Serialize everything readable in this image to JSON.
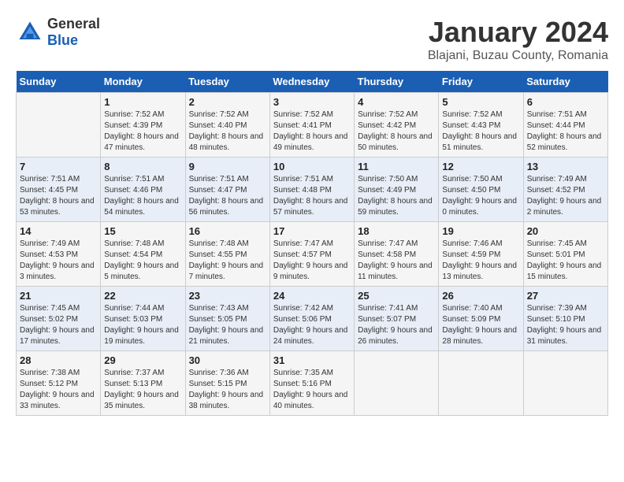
{
  "header": {
    "logo_general": "General",
    "logo_blue": "Blue",
    "month_title": "January 2024",
    "location": "Blajani, Buzau County, Romania"
  },
  "weekdays": [
    "Sunday",
    "Monday",
    "Tuesday",
    "Wednesday",
    "Thursday",
    "Friday",
    "Saturday"
  ],
  "weeks": [
    [
      {
        "day": "",
        "sunrise": "",
        "sunset": "",
        "daylight": ""
      },
      {
        "day": "1",
        "sunrise": "Sunrise: 7:52 AM",
        "sunset": "Sunset: 4:39 PM",
        "daylight": "Daylight: 8 hours and 47 minutes."
      },
      {
        "day": "2",
        "sunrise": "Sunrise: 7:52 AM",
        "sunset": "Sunset: 4:40 PM",
        "daylight": "Daylight: 8 hours and 48 minutes."
      },
      {
        "day": "3",
        "sunrise": "Sunrise: 7:52 AM",
        "sunset": "Sunset: 4:41 PM",
        "daylight": "Daylight: 8 hours and 49 minutes."
      },
      {
        "day": "4",
        "sunrise": "Sunrise: 7:52 AM",
        "sunset": "Sunset: 4:42 PM",
        "daylight": "Daylight: 8 hours and 50 minutes."
      },
      {
        "day": "5",
        "sunrise": "Sunrise: 7:52 AM",
        "sunset": "Sunset: 4:43 PM",
        "daylight": "Daylight: 8 hours and 51 minutes."
      },
      {
        "day": "6",
        "sunrise": "Sunrise: 7:51 AM",
        "sunset": "Sunset: 4:44 PM",
        "daylight": "Daylight: 8 hours and 52 minutes."
      }
    ],
    [
      {
        "day": "7",
        "sunrise": "Sunrise: 7:51 AM",
        "sunset": "Sunset: 4:45 PM",
        "daylight": "Daylight: 8 hours and 53 minutes."
      },
      {
        "day": "8",
        "sunrise": "Sunrise: 7:51 AM",
        "sunset": "Sunset: 4:46 PM",
        "daylight": "Daylight: 8 hours and 54 minutes."
      },
      {
        "day": "9",
        "sunrise": "Sunrise: 7:51 AM",
        "sunset": "Sunset: 4:47 PM",
        "daylight": "Daylight: 8 hours and 56 minutes."
      },
      {
        "day": "10",
        "sunrise": "Sunrise: 7:51 AM",
        "sunset": "Sunset: 4:48 PM",
        "daylight": "Daylight: 8 hours and 57 minutes."
      },
      {
        "day": "11",
        "sunrise": "Sunrise: 7:50 AM",
        "sunset": "Sunset: 4:49 PM",
        "daylight": "Daylight: 8 hours and 59 minutes."
      },
      {
        "day": "12",
        "sunrise": "Sunrise: 7:50 AM",
        "sunset": "Sunset: 4:50 PM",
        "daylight": "Daylight: 9 hours and 0 minutes."
      },
      {
        "day": "13",
        "sunrise": "Sunrise: 7:49 AM",
        "sunset": "Sunset: 4:52 PM",
        "daylight": "Daylight: 9 hours and 2 minutes."
      }
    ],
    [
      {
        "day": "14",
        "sunrise": "Sunrise: 7:49 AM",
        "sunset": "Sunset: 4:53 PM",
        "daylight": "Daylight: 9 hours and 3 minutes."
      },
      {
        "day": "15",
        "sunrise": "Sunrise: 7:48 AM",
        "sunset": "Sunset: 4:54 PM",
        "daylight": "Daylight: 9 hours and 5 minutes."
      },
      {
        "day": "16",
        "sunrise": "Sunrise: 7:48 AM",
        "sunset": "Sunset: 4:55 PM",
        "daylight": "Daylight: 9 hours and 7 minutes."
      },
      {
        "day": "17",
        "sunrise": "Sunrise: 7:47 AM",
        "sunset": "Sunset: 4:57 PM",
        "daylight": "Daylight: 9 hours and 9 minutes."
      },
      {
        "day": "18",
        "sunrise": "Sunrise: 7:47 AM",
        "sunset": "Sunset: 4:58 PM",
        "daylight": "Daylight: 9 hours and 11 minutes."
      },
      {
        "day": "19",
        "sunrise": "Sunrise: 7:46 AM",
        "sunset": "Sunset: 4:59 PM",
        "daylight": "Daylight: 9 hours and 13 minutes."
      },
      {
        "day": "20",
        "sunrise": "Sunrise: 7:45 AM",
        "sunset": "Sunset: 5:01 PM",
        "daylight": "Daylight: 9 hours and 15 minutes."
      }
    ],
    [
      {
        "day": "21",
        "sunrise": "Sunrise: 7:45 AM",
        "sunset": "Sunset: 5:02 PM",
        "daylight": "Daylight: 9 hours and 17 minutes."
      },
      {
        "day": "22",
        "sunrise": "Sunrise: 7:44 AM",
        "sunset": "Sunset: 5:03 PM",
        "daylight": "Daylight: 9 hours and 19 minutes."
      },
      {
        "day": "23",
        "sunrise": "Sunrise: 7:43 AM",
        "sunset": "Sunset: 5:05 PM",
        "daylight": "Daylight: 9 hours and 21 minutes."
      },
      {
        "day": "24",
        "sunrise": "Sunrise: 7:42 AM",
        "sunset": "Sunset: 5:06 PM",
        "daylight": "Daylight: 9 hours and 24 minutes."
      },
      {
        "day": "25",
        "sunrise": "Sunrise: 7:41 AM",
        "sunset": "Sunset: 5:07 PM",
        "daylight": "Daylight: 9 hours and 26 minutes."
      },
      {
        "day": "26",
        "sunrise": "Sunrise: 7:40 AM",
        "sunset": "Sunset: 5:09 PM",
        "daylight": "Daylight: 9 hours and 28 minutes."
      },
      {
        "day": "27",
        "sunrise": "Sunrise: 7:39 AM",
        "sunset": "Sunset: 5:10 PM",
        "daylight": "Daylight: 9 hours and 31 minutes."
      }
    ],
    [
      {
        "day": "28",
        "sunrise": "Sunrise: 7:38 AM",
        "sunset": "Sunset: 5:12 PM",
        "daylight": "Daylight: 9 hours and 33 minutes."
      },
      {
        "day": "29",
        "sunrise": "Sunrise: 7:37 AM",
        "sunset": "Sunset: 5:13 PM",
        "daylight": "Daylight: 9 hours and 35 minutes."
      },
      {
        "day": "30",
        "sunrise": "Sunrise: 7:36 AM",
        "sunset": "Sunset: 5:15 PM",
        "daylight": "Daylight: 9 hours and 38 minutes."
      },
      {
        "day": "31",
        "sunrise": "Sunrise: 7:35 AM",
        "sunset": "Sunset: 5:16 PM",
        "daylight": "Daylight: 9 hours and 40 minutes."
      },
      {
        "day": "",
        "sunrise": "",
        "sunset": "",
        "daylight": ""
      },
      {
        "day": "",
        "sunrise": "",
        "sunset": "",
        "daylight": ""
      },
      {
        "day": "",
        "sunrise": "",
        "sunset": "",
        "daylight": ""
      }
    ]
  ]
}
